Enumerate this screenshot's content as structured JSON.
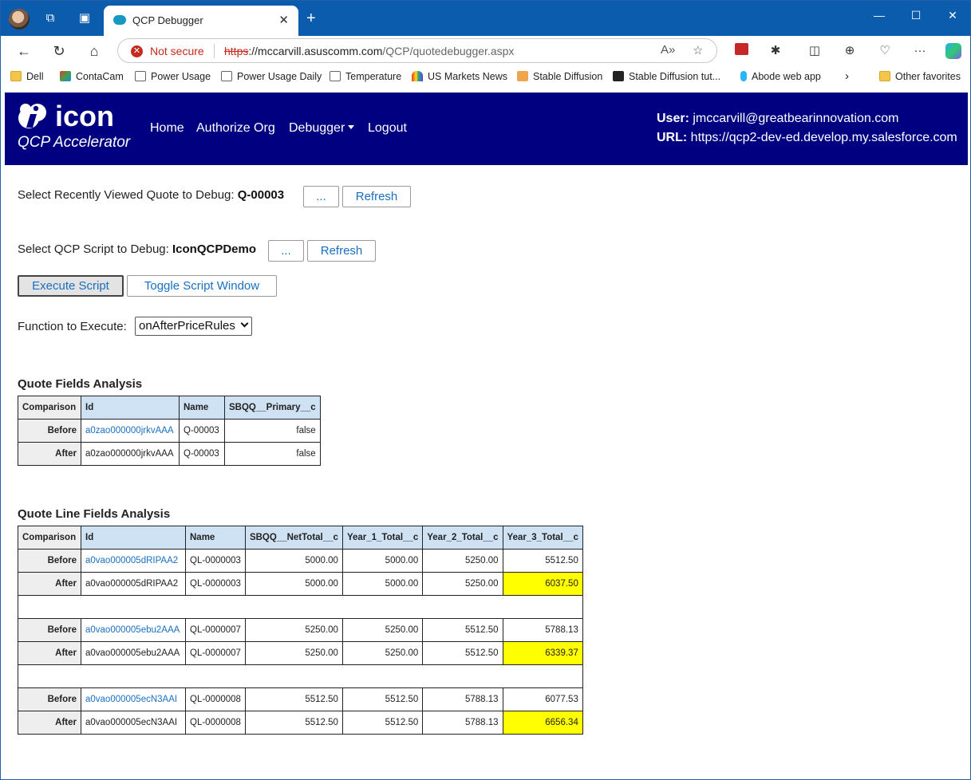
{
  "browser": {
    "tab_title": "QCP Debugger",
    "url": {
      "proto": "https",
      "rest_host": "://mccarvill.asuscomm.com",
      "path": "/QCP/quotedebugger.aspx"
    },
    "security_text": "Not secure",
    "favorites": [
      {
        "label": "Dell",
        "icon": "folder"
      },
      {
        "label": "ContaCam",
        "icon": "contacam"
      },
      {
        "label": "Power Usage",
        "icon": "page"
      },
      {
        "label": "Power Usage Daily",
        "icon": "page"
      },
      {
        "label": "Temperature",
        "icon": "page"
      },
      {
        "label": "US Markets News",
        "icon": "nbc"
      },
      {
        "label": "Stable Diffusion",
        "icon": "sd"
      },
      {
        "label": "Stable Diffusion tut...",
        "icon": "sd-tut"
      },
      {
        "label": "Abode web app",
        "icon": "abode"
      },
      {
        "label": "Other favorites",
        "icon": "folder"
      }
    ]
  },
  "header": {
    "logo_text": "icon",
    "logo_subtitle": "QCP Accelerator",
    "nav": [
      "Home",
      "Authorize Org",
      "Debugger",
      "Logout"
    ],
    "user_label": "User:",
    "user_value": "jmccarvill@greatbearinnovation.com",
    "url_label": "URL:",
    "url_value": "https://qcp2-dev-ed.develop.my.salesforce.com"
  },
  "controls": {
    "quote_prompt": "Select Recently Viewed Quote to Debug:",
    "quote_value": "Q-00003",
    "script_prompt": "Select QCP Script to Debug:",
    "script_value": "IconQCPDemo",
    "browse_label": "...",
    "refresh_label": "Refresh",
    "execute_label": "Execute Script",
    "toggle_label": "Toggle Script Window",
    "function_prompt": "Function to Execute:",
    "function_selected": "onAfterPriceRules"
  },
  "quote_fields": {
    "title": "Quote Fields Analysis",
    "headers": [
      "Comparison",
      "Id",
      "Name",
      "SBQQ__Primary__c"
    ],
    "rows": [
      [
        "Before",
        "a0zao000000jrkvAAA",
        "Q-00003",
        "false"
      ],
      [
        "After",
        "a0zao000000jrkvAAA",
        "Q-00003",
        "false"
      ]
    ]
  },
  "quote_line_fields": {
    "title": "Quote Line Fields Analysis",
    "headers": [
      "Comparison",
      "Id",
      "Name",
      "SBQQ__NetTotal__c",
      "Year_1_Total__c",
      "Year_2_Total__c",
      "Year_3_Total__c"
    ],
    "rows": [
      [
        "Before",
        "a0vao000005dRIPAA2",
        "QL-0000003",
        "5000.00",
        "5000.00",
        "5250.00",
        "5512.50"
      ],
      [
        "After",
        "a0vao000005dRIPAA2",
        "QL-0000003",
        "5000.00",
        "5000.00",
        "5250.00",
        "6037.50"
      ],
      [
        "Before",
        "a0vao000005ebu2AAA",
        "QL-0000007",
        "5250.00",
        "5250.00",
        "5512.50",
        "5788.13"
      ],
      [
        "After",
        "a0vao000005ebu2AAA",
        "QL-0000007",
        "5250.00",
        "5250.00",
        "5512.50",
        "6339.37"
      ],
      [
        "Before",
        "a0vao000005ecN3AAI",
        "QL-0000008",
        "5512.50",
        "5512.50",
        "5788.13",
        "6077.53"
      ],
      [
        "After",
        "a0vao000005ecN3AAI",
        "QL-0000008",
        "5512.50",
        "5512.50",
        "5788.13",
        "6656.34"
      ]
    ],
    "highlight_color": "#ffff00"
  }
}
